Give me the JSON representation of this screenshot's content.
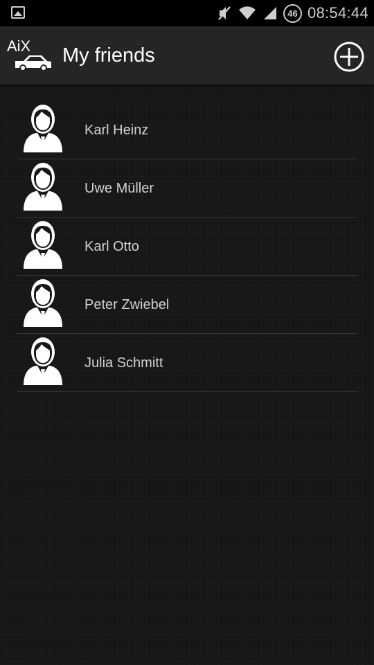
{
  "status_bar": {
    "icons": [
      "gallery-icon",
      "mute-icon",
      "wifi-icon",
      "signal-icon",
      "network-badge"
    ],
    "network_badge": "46",
    "time": "08:54:44"
  },
  "action_bar": {
    "logo_text": "AiX",
    "logo_icon": "car-icon",
    "title": "My friends",
    "add_icon": "add-circle-icon"
  },
  "friends": [
    {
      "name": "Karl Heinz",
      "avatar": "person-icon"
    },
    {
      "name": "Uwe Müller",
      "avatar": "person-icon"
    },
    {
      "name": "Karl Otto",
      "avatar": "person-icon"
    },
    {
      "name": "Peter Zwiebel",
      "avatar": "person-icon"
    },
    {
      "name": "Julia Schmitt",
      "avatar": "person-icon"
    }
  ],
  "colors": {
    "status_bar_bg": "#000000",
    "action_bar_bg": "#252525",
    "list_bg": "#171717",
    "text_primary": "#ffffff",
    "text_secondary": "#d2d2d2",
    "divider": "#363636"
  }
}
